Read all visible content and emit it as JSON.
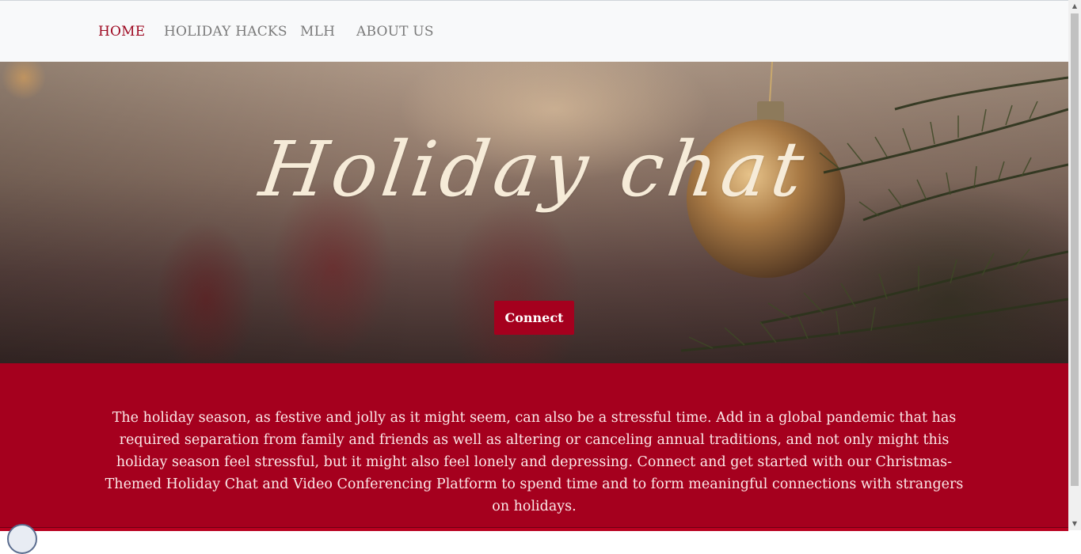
{
  "nav": {
    "items": [
      {
        "label": "HOME",
        "active": true
      },
      {
        "label": "HOLIDAY HACKS",
        "active": false
      },
      {
        "label": "MLH",
        "active": false
      },
      {
        "label": "ABOUT US",
        "active": false
      }
    ]
  },
  "hero": {
    "title": "Holiday chat",
    "connect_label": "Connect",
    "background_image": "blurred-christmas-stockings-and-gold-ornament-on-tree"
  },
  "about": {
    "text": "The holiday season, as festive and jolly as it might seem, can also be a stressful time. Add in a global pandemic that has required separation from family and friends as well as altering or canceling annual traditions, and not only might this holiday season feel stressful, but it might also feel lonely and depressing. Connect and get started with our Christmas-Themed Holiday Chat and Video Conferencing Platform to spend time and to form meaningful connections with strangers on holidays."
  },
  "colors": {
    "brand_red": "#a5001e",
    "nav_active": "#9e0a22",
    "nav_text": "#7a7a7a",
    "navbar_bg": "#f8f9fa",
    "title_cream": "#f6ebd8"
  },
  "icons": {
    "scroll_up": "scroll-up-arrow-icon",
    "scroll_down": "scroll-down-arrow-icon",
    "chat": "chat-widget-icon"
  }
}
